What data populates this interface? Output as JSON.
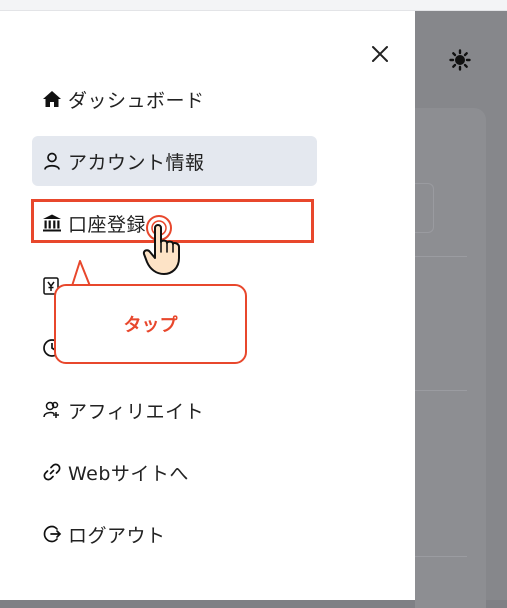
{
  "drawer": {
    "items": [
      {
        "label": "ダッシュボード",
        "icon": "home-icon"
      },
      {
        "label": "アカウント情報",
        "icon": "user-icon",
        "active": true
      },
      {
        "label": "口座登録",
        "icon": "bank-icon"
      },
      {
        "label": "",
        "icon": "yen-icon"
      },
      {
        "label": "",
        "icon": "clock-icon"
      },
      {
        "label": "アフィリエイト",
        "icon": "users-plus-icon"
      },
      {
        "label": "Webサイトへ",
        "icon": "link-icon"
      },
      {
        "label": "ログアウト",
        "icon": "logout-icon"
      }
    ]
  },
  "annotation": {
    "label": "タップ",
    "color": "#e8472c"
  },
  "colors": {
    "active_bg": "#e4e8ef",
    "overlay": "#808185"
  }
}
